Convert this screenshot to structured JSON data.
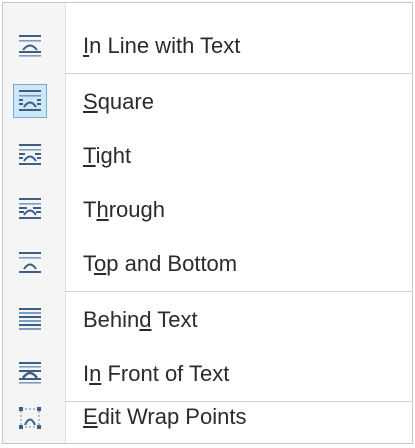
{
  "menu": {
    "items": [
      {
        "name": "in-line-with-text",
        "pre": "",
        "accel": "I",
        "post": "n Line with Text",
        "icon": "inline-wrap-icon",
        "selected": false
      },
      {
        "name": "square",
        "pre": "",
        "accel": "S",
        "post": "quare",
        "icon": "square-wrap-icon",
        "selected": true
      },
      {
        "name": "tight",
        "pre": "",
        "accel": "T",
        "post": "ight",
        "icon": "tight-wrap-icon",
        "selected": false
      },
      {
        "name": "through",
        "pre": "T",
        "accel": "h",
        "post": "rough",
        "icon": "through-wrap-icon",
        "selected": false
      },
      {
        "name": "top-and-bottom",
        "pre": "T",
        "accel": "o",
        "post": "p and Bottom",
        "icon": "top-bottom-wrap-icon",
        "selected": false
      },
      {
        "name": "behind-text",
        "pre": "Behin",
        "accel": "d",
        "post": " Text",
        "icon": "behind-text-icon",
        "selected": false
      },
      {
        "name": "in-front-of-text",
        "pre": "I",
        "accel": "n",
        "post": " Front of Text",
        "icon": "in-front-text-icon",
        "selected": false
      },
      {
        "name": "edit-wrap-points",
        "pre": "",
        "accel": "E",
        "post": "dit Wrap Points",
        "icon": "edit-wrap-points-icon",
        "selected": false
      }
    ]
  },
  "colors": {
    "icon_dark": "#3b5f86",
    "icon_light": "#7d9dbe",
    "selected_bg": "#cfe6f7",
    "selected_border": "#76a9d3"
  }
}
